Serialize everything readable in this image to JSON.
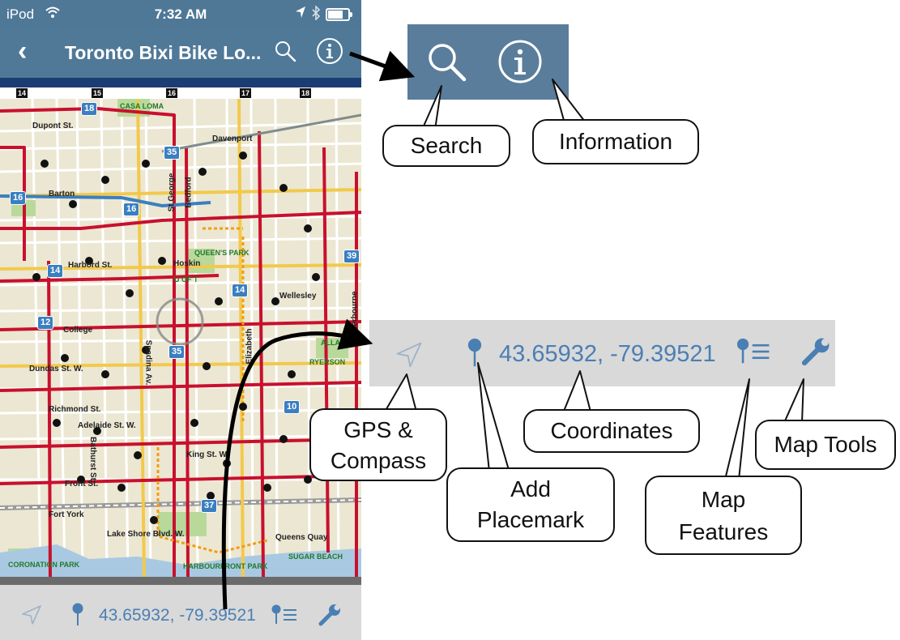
{
  "status_bar": {
    "carrier": "iPod",
    "time": "7:32 AM"
  },
  "nav_bar": {
    "back_glyph": "‹",
    "title": "Toronto Bixi Bike Lo...",
    "icons": [
      "back-chevron-icon",
      "search-icon",
      "info-icon"
    ]
  },
  "map": {
    "grid_numbers": [
      "14",
      "15",
      "16",
      "17",
      "18"
    ],
    "labels": {
      "casa_loma": "CASA LOMA",
      "dupont": "Dupont St.",
      "davenport": "Davenport",
      "barton": "Barton",
      "bedford": "Bedford",
      "st_george": "St George",
      "harbord": "Harbord St.",
      "hoskin": "Hoskin",
      "queens_park": "QUEEN'S PARK",
      "u_of_t": "U OF T",
      "wellesley": "Wellesley",
      "college": "College",
      "dundas": "Dundas St. W.",
      "allan_gardens": "ALLAN GARDENS",
      "ryerson": "RYERSON",
      "richmond": "Richmond St.",
      "adelaide": "Adelaide St. W.",
      "king": "King St. W.",
      "front": "Front St.",
      "fort_york": "Fort York",
      "lake_shore": "Lake Shore Blvd. W.",
      "queens_quay": "Queens Quay",
      "sugar_beach": "SUGAR BEACH",
      "harbourfront": "HARBOURFRONT PARK",
      "coronation": "CORONATION PARK",
      "elizabeth": "Elizabeth",
      "sherbourne": "Sherbourne",
      "spadina": "Spadina Av.",
      "bathurst": "Bathurst St."
    },
    "route_shields": [
      "18",
      "35",
      "16",
      "16",
      "14",
      "14",
      "39",
      "12",
      "35",
      "10",
      "37"
    ]
  },
  "toolbar": {
    "coordinates": "43.65932, -79.39521",
    "icons": [
      "gps-compass-icon",
      "add-placemark-icon",
      "map-features-icon",
      "map-tools-icon"
    ]
  },
  "callouts": {
    "search": "Search",
    "information": "Information",
    "gps_compass": "GPS & Compass",
    "coordinates": "Coordinates",
    "map_tools": "Map Tools",
    "add_placemark": "Add Placemark",
    "map_features": "Map Features"
  },
  "colors": {
    "nav_blue": "#507998",
    "toolbar_gray": "#d9d9d9",
    "accent_blue": "#4a7fb4",
    "route_red": "#c8102e"
  }
}
